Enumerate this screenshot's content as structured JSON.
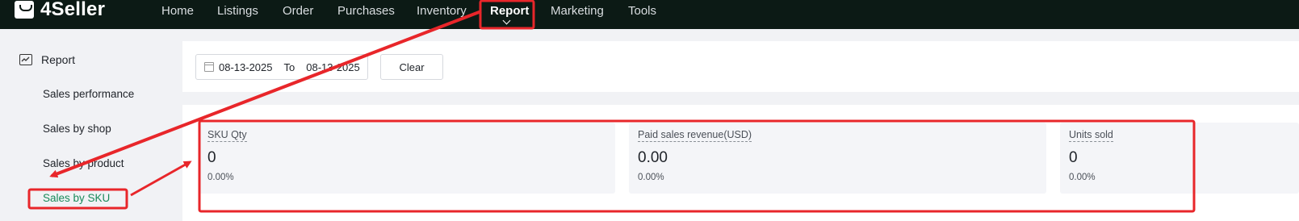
{
  "brand": {
    "name": "4Seller"
  },
  "nav": {
    "items": [
      {
        "label": "Home"
      },
      {
        "label": "Listings"
      },
      {
        "label": "Order"
      },
      {
        "label": "Purchases"
      },
      {
        "label": "Inventory"
      },
      {
        "label": "Report",
        "active": true
      },
      {
        "label": "Marketing"
      },
      {
        "label": "Tools"
      }
    ]
  },
  "sidebar": {
    "header": {
      "label": "Report",
      "icon": "chart-line-icon"
    },
    "items": [
      {
        "label": "Sales performance"
      },
      {
        "label": "Sales by shop"
      },
      {
        "label": "Sales by product"
      },
      {
        "label": "Sales by SKU",
        "active": true
      }
    ]
  },
  "filter": {
    "date_start": "08-13-2025",
    "to_label": "To",
    "date_end": "08-13-2025",
    "clear_label": "Clear"
  },
  "metrics": [
    {
      "label": "SKU Qty",
      "value": "0",
      "change": "0.00%"
    },
    {
      "label": "Paid sales revenue(USD)",
      "value": "0.00",
      "change": "0.00%"
    },
    {
      "label": "Units sold",
      "value": "0",
      "change": "0.00%"
    }
  ],
  "colors": {
    "topbar": "#0c1a15",
    "accent": "#1a8a5a",
    "annotation": "#e8262a"
  }
}
